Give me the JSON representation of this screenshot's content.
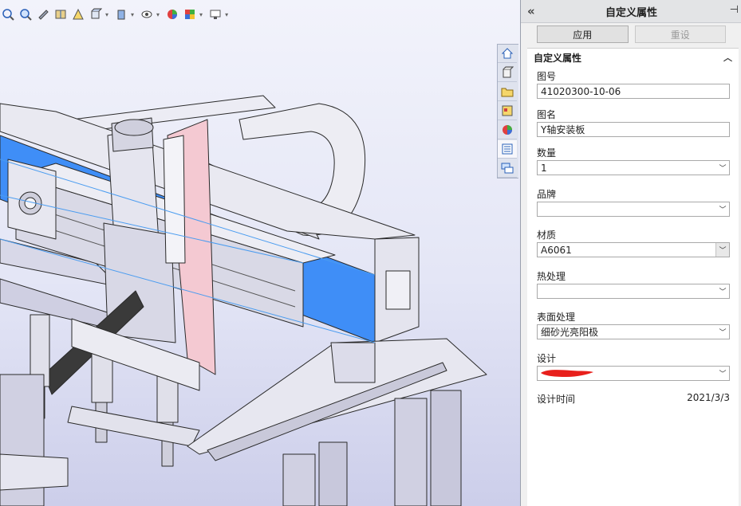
{
  "toolbar": {
    "icons": [
      "zoom-fit-icon",
      "zoom-area-icon",
      "previous-view-icon",
      "section-view-icon",
      "dynamic-annotation-icon",
      "view-orientation-icon",
      "display-style-icon",
      "hide-show-icon",
      "edit-appearance-icon",
      "apply-scene-icon",
      "view-settings-icon"
    ]
  },
  "taskpane_tabs": [
    "home-icon",
    "design-library-icon",
    "file-explorer-icon",
    "view-palette-icon",
    "appearances-icon",
    "custom-properties-icon",
    "forum-icon"
  ],
  "panel": {
    "collapse_glyph": "«",
    "title": "自定义属性",
    "pin_glyph": "⊣",
    "apply_label": "应用",
    "reset_label": "重设",
    "section_title": "自定义属性",
    "fields": {
      "drawing_no": {
        "label": "图号",
        "value": "41020300-10-06"
      },
      "drawing_name": {
        "label": "图名",
        "value": "Y轴安装板"
      },
      "quantity": {
        "label": "数量",
        "value": "1"
      },
      "brand": {
        "label": "品牌",
        "value": ""
      },
      "material": {
        "label": "材质",
        "value": "A6061"
      },
      "heat_treatment": {
        "label": "热处理",
        "value": ""
      },
      "surface_treatment": {
        "label": "表面处理",
        "value": "细砂光亮阳极"
      },
      "designer": {
        "label": "设计",
        "value": ""
      }
    },
    "design_time": {
      "label": "设计时间",
      "value": "2021/3/3"
    }
  },
  "colors": {
    "selected_face": "#3f8ef7",
    "pink_face": "#f4c9d2",
    "part_face": "#dcdcec",
    "redaction": "#e8201c"
  }
}
